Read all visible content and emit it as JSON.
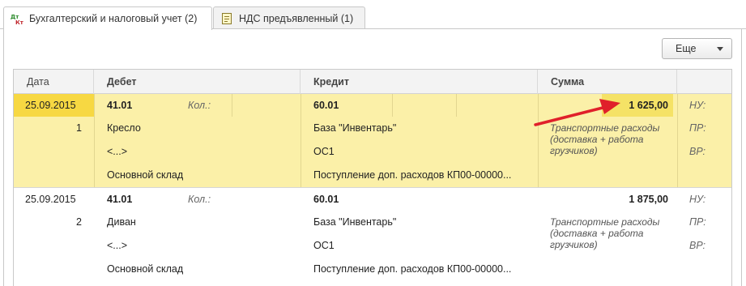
{
  "tabs": [
    {
      "label": "Бухгалтерский и налоговый учет (2)",
      "icon": "dt-kt-icon",
      "active": true
    },
    {
      "label": "НДС предъявленный (1)",
      "icon": "document-icon",
      "active": false
    }
  ],
  "toolbar": {
    "more_label": "Еще"
  },
  "table": {
    "headers": {
      "date": "Дата",
      "debit": "Дебет",
      "credit": "Кредит",
      "sum": "Сумма"
    },
    "rows": [
      {
        "date": "25.09.2015",
        "num": "1",
        "debit_account": "41.01",
        "qty_label": "Кол.:",
        "debit_sub1": "Кресло",
        "debit_sub2": "<...>",
        "debit_sub3": "Основной склад",
        "credit_account": "60.01",
        "credit_sub1": "База \"Инвентарь\"",
        "credit_sub2": "ОС1",
        "credit_sub3": "Поступление доп. расходов КП00-00000...",
        "amount": "1 625,00",
        "description": "Транспортные расходы (доставка + работа грузчиков)",
        "nu": "НУ:",
        "pr": "ПР:",
        "vr": "ВР:",
        "selected": true
      },
      {
        "date": "25.09.2015",
        "num": "2",
        "debit_account": "41.01",
        "qty_label": "Кол.:",
        "debit_sub1": "Диван",
        "debit_sub2": "<...>",
        "debit_sub3": "Основной склад",
        "credit_account": "60.01",
        "credit_sub1": "База \"Инвентарь\"",
        "credit_sub2": "ОС1",
        "credit_sub3": "Поступление доп. расходов КП00-00000...",
        "amount": "1 875,00",
        "description": "Транспортные расходы (доставка + работа грузчиков)",
        "nu": "НУ:",
        "pr": "ПР:",
        "vr": "ВР:",
        "selected": false
      }
    ]
  },
  "colors": {
    "selection": "#fbf0a8",
    "selected_date": "#f7d842",
    "arrow": "#e0202a"
  }
}
